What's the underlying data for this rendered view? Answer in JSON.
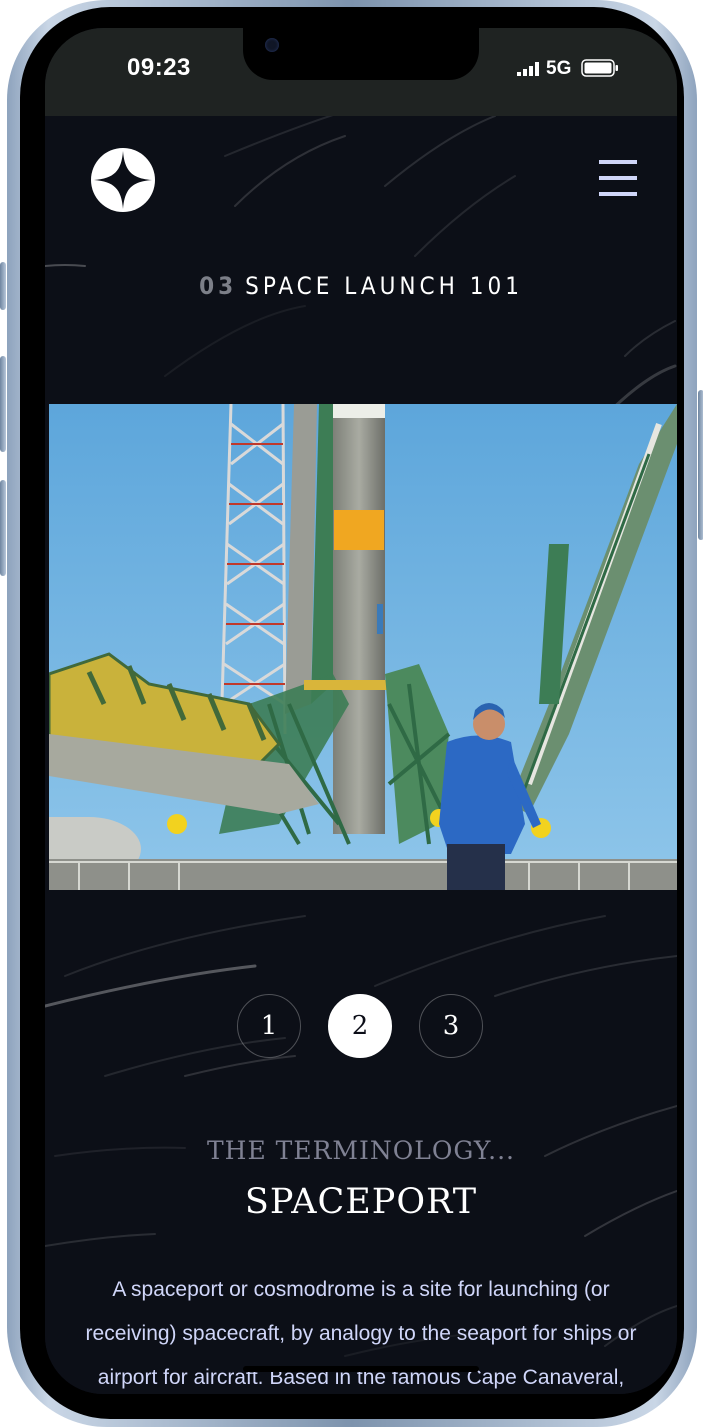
{
  "status_bar": {
    "time": "09:23",
    "network": "5G"
  },
  "header": {
    "logo_icon": "star-logo-icon",
    "menu_icon": "hamburger-menu-icon"
  },
  "page": {
    "section_number": "03",
    "section_title": "SPACE LAUNCH 101"
  },
  "slide_nav": {
    "items": [
      "1",
      "2",
      "3"
    ],
    "active": "2"
  },
  "slide": {
    "eyebrow": "THE TERMINOLOGY...",
    "title": "SPACEPORT",
    "body": "A spaceport or cosmodrome is a site for launching (or receiving) spacecraft, by analogy to the seaport for ships or airport for aircraft. Based in the famous Cape Canaveral, our spaceport is ideally"
  },
  "colors": {
    "background": "#0c0f17",
    "text_light": "#d0d6f9",
    "muted": "#7f8193",
    "white": "#ffffff"
  }
}
